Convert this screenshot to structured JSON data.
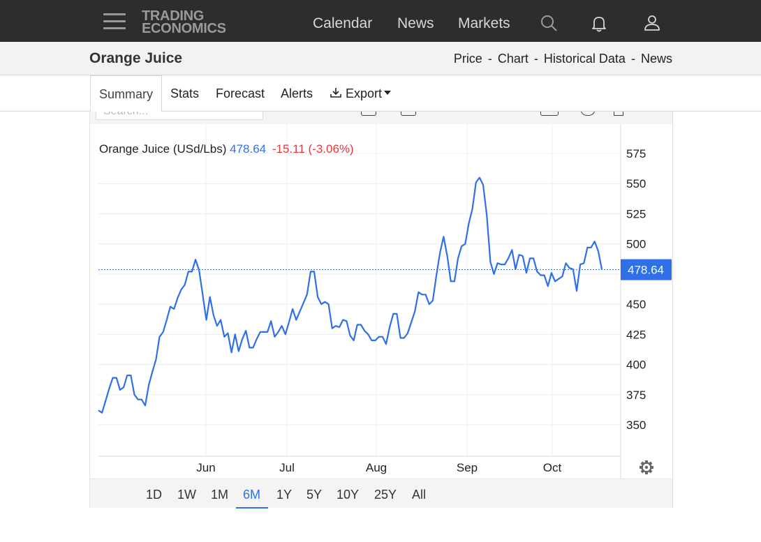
{
  "nav": {
    "logo_line1": "TRADING",
    "logo_line2": "ECONOMICS",
    "links": [
      "Calendar",
      "News",
      "Markets"
    ]
  },
  "header": {
    "title": "Orange Juice",
    "links": [
      "Price",
      "Chart",
      "Historical Data",
      "News"
    ],
    "separator": "-"
  },
  "tabs": {
    "summary": "Summary",
    "stats": "Stats",
    "forecast": "Forecast",
    "alerts": "Alerts",
    "export": "Export"
  },
  "toolbar": {
    "search_placeholder": "Search..."
  },
  "quote": {
    "name": "Orange Juice (USd/Lbs)",
    "price": "478.64",
    "change": "-15.11",
    "change_pct": "(-3.06%)"
  },
  "ranges": [
    "1D",
    "1W",
    "1M",
    "6M",
    "1Y",
    "5Y",
    "10Y",
    "25Y",
    "All"
  ],
  "active_range": "6M",
  "colors": {
    "line": "#2f6fe8",
    "negative": "#e0393e",
    "price_tag_bg": "#2f6fe8",
    "navbar_bg": "#2d2d2d"
  },
  "chart_data": {
    "type": "line",
    "title": "Orange Juice (USd/Lbs)",
    "xlabel": "",
    "ylabel": "",
    "ylim": [
      325,
      587
    ],
    "y_ticks": [
      350,
      375,
      400,
      425,
      450,
      500,
      525,
      550,
      575
    ],
    "x_ticks": [
      "Jun",
      "Jul",
      "Aug",
      "Sep",
      "Oct"
    ],
    "last_value": 478.64,
    "grid": true,
    "series": [
      {
        "name": "Orange Juice",
        "values": [
          362,
          360,
          370,
          380,
          389,
          389,
          379,
          381,
          391,
          391,
          375,
          371,
          371,
          366,
          383,
          394,
          404,
          423,
          427,
          437,
          448,
          446,
          455,
          462,
          466,
          477,
          477,
          487,
          478,
          458,
          437,
          456,
          441,
          432,
          437,
          423,
          426,
          410,
          425,
          411,
          421,
          428,
          414,
          414,
          421,
          427,
          427,
          427,
          436,
          423,
          427,
          432,
          425,
          435,
          446,
          437,
          444,
          451,
          458,
          477,
          477,
          456,
          450,
          452,
          450,
          430,
          432,
          431,
          437,
          436,
          424,
          420,
          433,
          433,
          428,
          425,
          420,
          420,
          423,
          423,
          417,
          431,
          442,
          442,
          422,
          422,
          426,
          435,
          444,
          460,
          458,
          458,
          450,
          453,
          474,
          493,
          506,
          490,
          469,
          469,
          488,
          498,
          500,
          517,
          529,
          551,
          555,
          549,
          524,
          485,
          475,
          484,
          483,
          483,
          488,
          495,
          479,
          491,
          490,
          476,
          488,
          488,
          477,
          474,
          474,
          465,
          476,
          469,
          471,
          473,
          484,
          480,
          479,
          461,
          483,
          484,
          497,
          497,
          502,
          494,
          479
        ]
      }
    ]
  }
}
